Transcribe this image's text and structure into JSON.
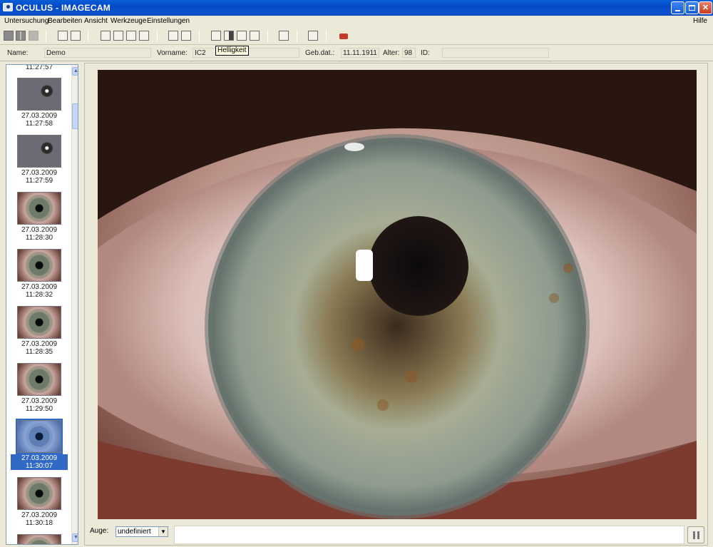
{
  "window": {
    "title": "OCULUS  -  IMAGECAM"
  },
  "menu": {
    "items": [
      "Untersuchung",
      "Bearbeiten",
      "Ansicht",
      "Werkzeuge",
      "Einstellungen"
    ],
    "help": "Hilfe"
  },
  "toolbar": {
    "tools": [
      {
        "icon": "single-view-icon"
      },
      {
        "icon": "grid-view-icon"
      },
      {
        "icon": "save-icon"
      },
      {
        "icon": "zoom-1to1-icon"
      },
      {
        "icon": "fit-screen-icon"
      },
      {
        "icon": "hand-pan-icon"
      },
      {
        "icon": "zoom-icon"
      },
      {
        "icon": "frame-icon"
      },
      {
        "icon": "measure-icon"
      },
      {
        "icon": "prev-icon"
      },
      {
        "icon": "next-icon"
      },
      {
        "icon": "brightness-icon"
      },
      {
        "icon": "contrast-icon"
      },
      {
        "icon": "gamma-icon"
      },
      {
        "icon": "rgb-icon"
      },
      {
        "icon": "delete-icon"
      },
      {
        "icon": "export-icon"
      },
      {
        "icon": "camera-icon"
      }
    ],
    "tooltip": "Helligkeit"
  },
  "patient": {
    "name_label": "Name:",
    "name": "Demo",
    "firstname_label": "Vorname:",
    "firstname": "IC2",
    "dob_label": "Geb.dat.:",
    "dob": "11.11.1911",
    "age_label": "Alter:",
    "age": "98",
    "id_label": "ID:",
    "id": ""
  },
  "thumbnails": {
    "partial_top_time": "11:27:57",
    "items": [
      {
        "date": "27.03.2009",
        "time": "11:27:58",
        "kind": "close"
      },
      {
        "date": "27.03.2009",
        "time": "11:27:59",
        "kind": "close"
      },
      {
        "date": "27.03.2009",
        "time": "11:28:30",
        "kind": "full"
      },
      {
        "date": "27.03.2009",
        "time": "11:28:32",
        "kind": "full"
      },
      {
        "date": "27.03.2009",
        "time": "11:28:35",
        "kind": "full"
      },
      {
        "date": "27.03.2009",
        "time": "11:29:50",
        "kind": "full"
      },
      {
        "date": "27.03.2009",
        "time": "11:30:07",
        "kind": "full",
        "selected": true
      },
      {
        "date": "27.03.2009",
        "time": "11:30:18",
        "kind": "full"
      }
    ]
  },
  "bottom": {
    "eye_label": "Auge:",
    "eye_value": "undefiniert"
  },
  "colors": {
    "titlebar": "#0348c6",
    "selection": "#3169c6",
    "background": "#ece9d8"
  }
}
